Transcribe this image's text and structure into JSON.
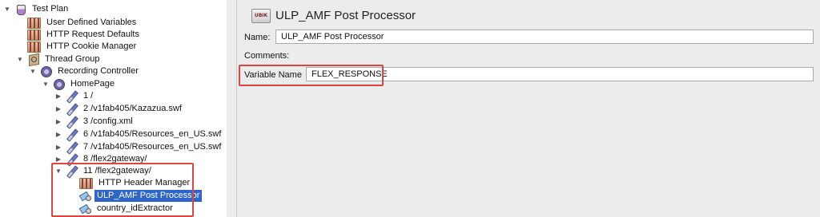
{
  "tree": {
    "items": [
      {
        "label": "Test Plan",
        "icon": "flask-icon",
        "expanded": true,
        "has_toggle": true
      },
      {
        "label": "User Defined Variables",
        "icon": "config-element-icon",
        "has_toggle": false
      },
      {
        "label": "HTTP Request Defaults",
        "icon": "config-element-icon",
        "has_toggle": false
      },
      {
        "label": "HTTP Cookie Manager",
        "icon": "config-element-icon",
        "has_toggle": false
      },
      {
        "label": "Thread Group",
        "icon": "thread-group-icon",
        "expanded": true,
        "has_toggle": true
      },
      {
        "label": "Recording Controller",
        "icon": "controller-icon",
        "expanded": true,
        "has_toggle": true
      },
      {
        "label": "HomePage",
        "icon": "controller-icon",
        "expanded": true,
        "has_toggle": true
      },
      {
        "label": "1 /",
        "icon": "sampler-icon",
        "expanded": false,
        "has_toggle": true
      },
      {
        "label": "2 /v1fab405/Kazazua.swf",
        "icon": "sampler-icon",
        "expanded": false,
        "has_toggle": true
      },
      {
        "label": "3 /config.xml",
        "icon": "sampler-icon",
        "expanded": false,
        "has_toggle": true
      },
      {
        "label": "6 /v1fab405/Resources_en_US.swf",
        "icon": "sampler-icon",
        "expanded": false,
        "has_toggle": true
      },
      {
        "label": "7 /v1fab405/Resources_en_US.swf",
        "icon": "sampler-icon",
        "expanded": false,
        "has_toggle": true
      },
      {
        "label": "8 /flex2gateway/",
        "icon": "sampler-icon",
        "expanded": false,
        "has_toggle": true
      },
      {
        "label": "11 /flex2gateway/",
        "icon": "sampler-icon",
        "expanded": true,
        "has_toggle": true
      },
      {
        "label": "HTTP Header Manager",
        "icon": "config-element-icon",
        "has_toggle": false
      },
      {
        "label": "ULP_AMF Post Processor",
        "icon": "post-processor-icon",
        "has_toggle": false,
        "selected": true
      },
      {
        "label": "country_idExtractor",
        "icon": "post-processor-icon",
        "has_toggle": false
      }
    ]
  },
  "panel": {
    "icon_text": "UBIK",
    "title": "ULP_AMF Post Processor",
    "name_label": "Name:",
    "name_value": "ULP_AMF Post Processor",
    "comments_label": "Comments:",
    "variable_label": "Variable Name",
    "variable_value": "FLEX_RESPONSE"
  },
  "colors": {
    "selection": "#2f65c9",
    "highlight_box": "#e0443e"
  }
}
